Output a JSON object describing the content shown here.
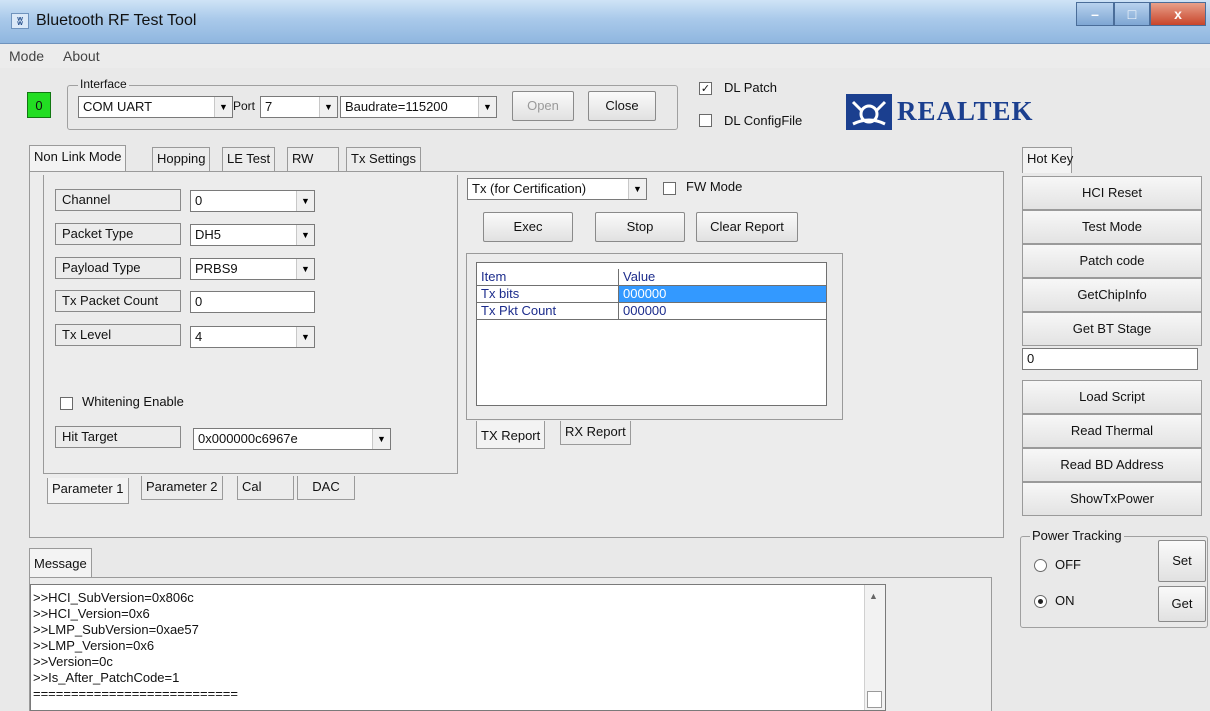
{
  "window": {
    "title": "Bluetooth RF Test Tool",
    "icon": "bluetooth-tool-icon",
    "minimize": "–",
    "maximize": "□",
    "close": "x"
  },
  "menu": [
    "Mode",
    "About"
  ],
  "status_led": {
    "value": "0",
    "color": "#22dd22"
  },
  "interface": {
    "group_label": "Interface",
    "port_type": "COM UART",
    "port_label": "Port",
    "port": "7",
    "baudrate": "Baudrate=115200",
    "open_label": "Open",
    "close_label": "Close"
  },
  "options": {
    "dl_patch": {
      "label": "DL Patch",
      "checked": true
    },
    "dl_configfile": {
      "label": "DL ConfigFile",
      "checked": false
    }
  },
  "brand": {
    "logo_text": "REALTEK",
    "color": "#1b3f8f"
  },
  "main_tabs": [
    "Non Link Mode",
    "Hopping",
    "LE Test",
    "RW",
    "Tx Settings"
  ],
  "params": {
    "channel": {
      "label": "Channel",
      "value": "0"
    },
    "packet_type": {
      "label": "Packet Type",
      "value": "DH5"
    },
    "payload_type": {
      "label": "Payload Type",
      "value": "PRBS9"
    },
    "tx_packet_count": {
      "label": "Tx Packet Count",
      "value": "0"
    },
    "tx_level": {
      "label": "Tx Level",
      "value": "4"
    },
    "whitening": {
      "label": "Whitening Enable",
      "checked": false
    },
    "hit_target": {
      "label": "Hit Target",
      "value": "0x000000c6967e"
    }
  },
  "param_tabs": [
    "Parameter 1",
    "Parameter 2",
    "Cal",
    "DAC"
  ],
  "test": {
    "mode": "Tx (for Certification)",
    "fw_mode": {
      "label": "FW Mode",
      "checked": false
    },
    "exec_label": "Exec",
    "stop_label": "Stop",
    "clear_label": "Clear Report"
  },
  "report": {
    "headers": [
      "Item",
      "Value"
    ],
    "rows": [
      {
        "item": "Tx bits",
        "value": "000000"
      },
      {
        "item": "Tx Pkt Count",
        "value": "000000"
      }
    ],
    "tabs": [
      "TX Report",
      "RX Report"
    ]
  },
  "hotkey": {
    "tab": "Hot Key",
    "buttons_top": [
      "HCI Reset",
      "Test Mode",
      "Patch code",
      "GetChipInfo",
      "Get BT Stage"
    ],
    "input_value": "0",
    "buttons_bottom": [
      "Load Script",
      "Read Thermal",
      "Read BD Address",
      "ShowTxPower"
    ]
  },
  "power_tracking": {
    "label": "Power Tracking",
    "off_label": "OFF",
    "on_label": "ON",
    "selected": "ON",
    "set_label": "Set",
    "get_label": "Get"
  },
  "message": {
    "tab": "Message",
    "lines": [
      ">>HCI_SubVersion=0x806c",
      ">>HCI_Version=0x6",
      ">>LMP_SubVersion=0xae57",
      ">>LMP_Version=0x6",
      ">>Version=0c",
      ">>Is_After_PatchCode=1",
      "==========================="
    ]
  }
}
